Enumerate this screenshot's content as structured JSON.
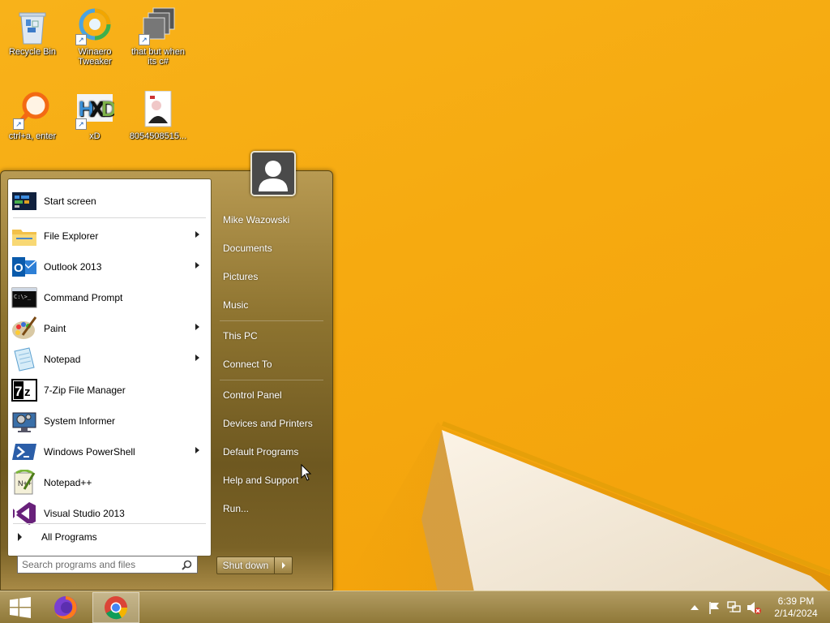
{
  "desktop": {
    "icons": [
      {
        "label": "Recycle Bin",
        "icon": "recycle-bin-icon"
      },
      {
        "label": "Winaero Tweaker",
        "icon": "winaero-tweaker-icon"
      },
      {
        "label": "that but when its c#",
        "icon": "folder-stack-icon"
      },
      {
        "label": "ctrl+a, enter",
        "icon": "magnifier-app-icon"
      },
      {
        "label": "xD",
        "icon": "hxd-icon"
      },
      {
        "label": "8054508515...",
        "icon": "image-file-icon"
      }
    ]
  },
  "start_menu": {
    "programs": [
      {
        "label": "Start screen",
        "icon": "start-screen-icon",
        "submenu": false
      },
      {
        "label": "File Explorer",
        "icon": "file-explorer-icon",
        "submenu": true
      },
      {
        "label": "Outlook 2013",
        "icon": "outlook-icon",
        "submenu": true
      },
      {
        "label": "Command Prompt",
        "icon": "command-prompt-icon",
        "submenu": false
      },
      {
        "label": "Paint",
        "icon": "paint-icon",
        "submenu": true
      },
      {
        "label": "Notepad",
        "icon": "notepad-icon",
        "submenu": true
      },
      {
        "label": "7-Zip File Manager",
        "icon": "7zip-icon",
        "submenu": false
      },
      {
        "label": "System Informer",
        "icon": "system-informer-icon",
        "submenu": false
      },
      {
        "label": "Windows PowerShell",
        "icon": "powershell-icon",
        "submenu": true
      },
      {
        "label": "Notepad++",
        "icon": "notepad-plus-plus-icon",
        "submenu": false
      },
      {
        "label": "Visual Studio 2013",
        "icon": "visual-studio-icon",
        "submenu": false
      }
    ],
    "all_programs": "All Programs",
    "search": {
      "placeholder": "Search programs and files",
      "value": ""
    },
    "user_name": "Mike Wazowski",
    "places": [
      {
        "label": "Mike Wazowski"
      },
      {
        "label": "Documents"
      },
      {
        "label": "Pictures"
      },
      {
        "label": "Music"
      },
      {
        "label": "This PC"
      },
      {
        "label": "Connect To"
      },
      {
        "label": "Control Panel"
      },
      {
        "label": "Devices and Printers"
      },
      {
        "label": "Default Programs"
      },
      {
        "label": "Help and Support"
      },
      {
        "label": "Run..."
      }
    ],
    "shutdown_label": "Shut down"
  },
  "taskbar": {
    "pinned": [
      {
        "name": "Firefox",
        "icon": "firefox-icon",
        "active": false
      },
      {
        "name": "Chrome",
        "icon": "chrome-icon",
        "active": true
      }
    ],
    "tray": [
      "show-hidden-icons",
      "action-center-flag-icon",
      "network-icon",
      "volume-muted-icon"
    ],
    "time": "6:39 PM",
    "date": "2/14/2024"
  },
  "colors": {
    "wallpaper": "#f6aa10",
    "taskbar": "#a08a4c",
    "start_menu": "#8e7430"
  }
}
